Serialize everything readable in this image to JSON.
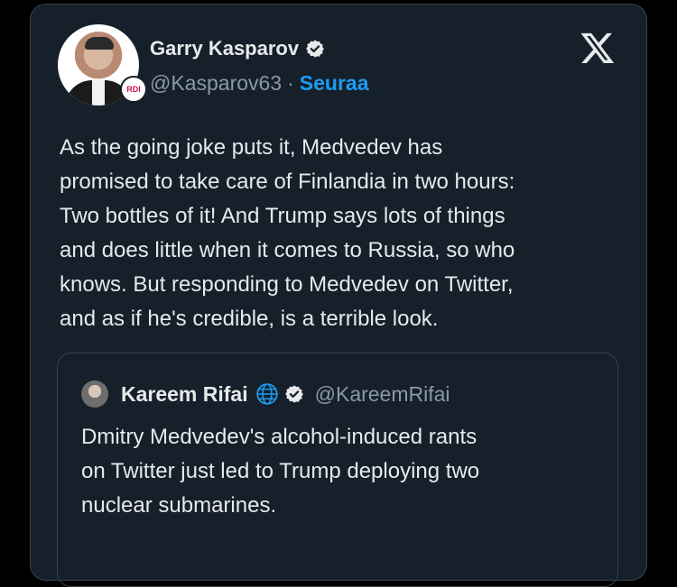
{
  "tweet": {
    "author_name": "Garry Kasparov",
    "author_handle": "@Kasparov63",
    "separator": "·",
    "follow_label": "Seuraa",
    "avatar_badge": "RDI",
    "text": "As the going joke puts it, Medvedev has\npromised to take care of Finlandia in two hours:\nTwo bottles of it! And Trump says lots of things\nand does little when it comes to Russia, so who\nknows. But responding to Medvedev on Twitter,\nand as if he's credible, is a terrible look."
  },
  "quote": {
    "author_name": "Kareem Rifai",
    "author_handle": "@KareemRifai",
    "text": "Dmitry Medvedev's alcohol-induced rants\non Twitter just led to Trump deploying two\nnuclear submarines."
  },
  "colors": {
    "background": "#000000",
    "card": "#15202b",
    "border": "#38444d",
    "accent": "#1d9bf0",
    "secondary_text": "#8b98a5",
    "primary_text": "#e7e9ea"
  },
  "icons": {
    "close": "x-logo-icon",
    "verified": "verified-badge-icon",
    "globe": "globe-icon"
  }
}
